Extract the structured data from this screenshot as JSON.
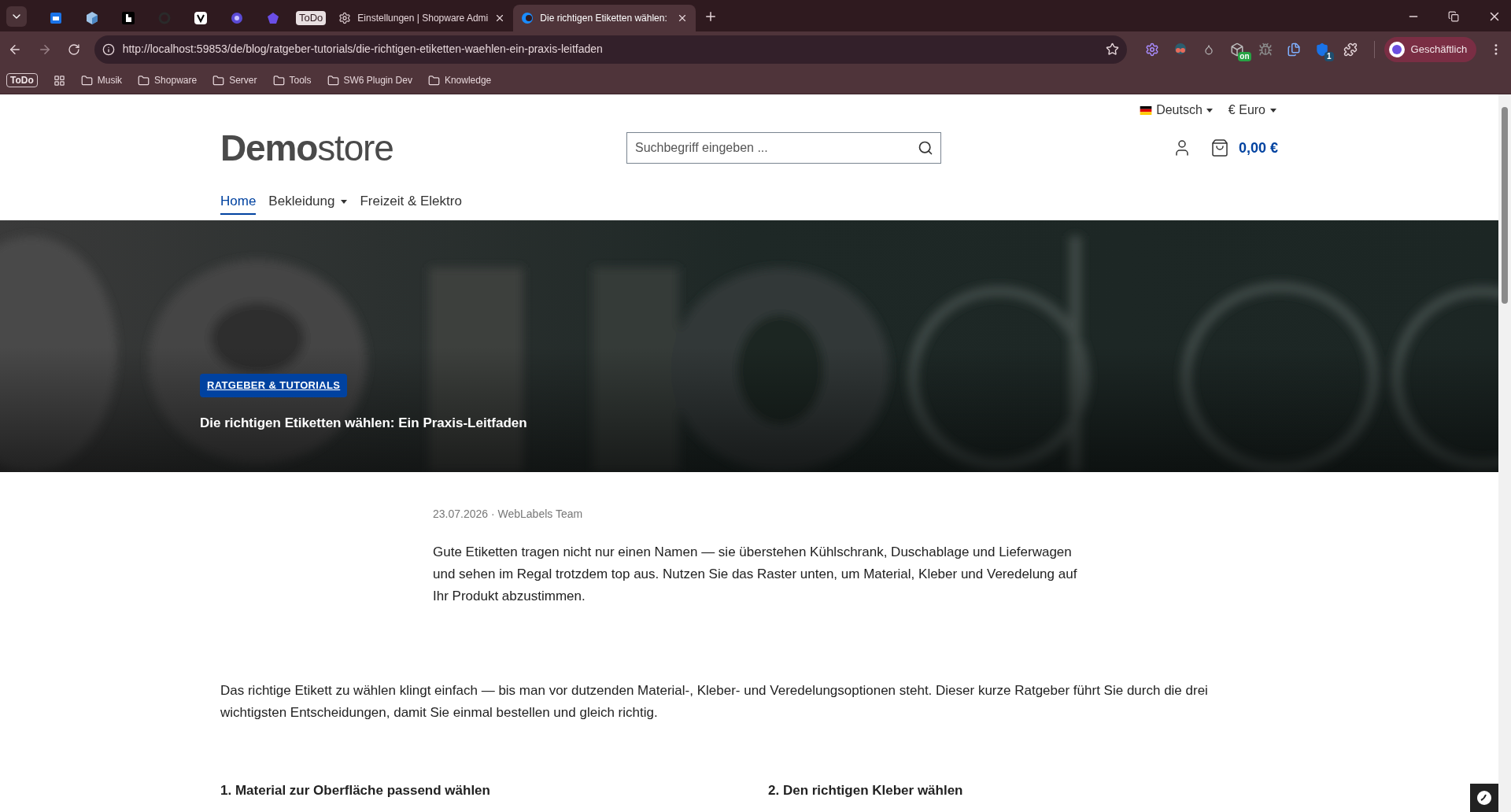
{
  "browser": {
    "tabs": [
      {
        "kind": "pinned",
        "selected": false
      },
      {
        "kind": "pinned",
        "selected": false
      },
      {
        "kind": "pinned",
        "selected": false
      },
      {
        "kind": "pinned",
        "selected": false
      },
      {
        "kind": "pinned",
        "selected": false
      },
      {
        "kind": "pinned",
        "selected": false
      },
      {
        "kind": "pinned",
        "selected": false
      },
      {
        "kind": "label",
        "label": "ToDo",
        "selected": false
      },
      {
        "kind": "page",
        "label": "Einstellungen | Shopware Admi",
        "selected": false
      },
      {
        "kind": "page",
        "label": "Die richtigen Etiketten wählen:",
        "selected": true
      }
    ],
    "address": "http://localhost:59853/de/blog/ratgeber-tutorials/die-richtigen-etiketten-waehlen-ein-praxis-leitfaden",
    "extensions": [
      {
        "kind": "gear"
      },
      {
        "kind": "goggles"
      },
      {
        "kind": "drop"
      },
      {
        "kind": "box",
        "badge": "on"
      },
      {
        "kind": "bug"
      },
      {
        "kind": "copy"
      },
      {
        "kind": "shield",
        "badge": "1"
      },
      {
        "kind": "puzzle"
      }
    ],
    "profile": "Geschäftlich",
    "bookmarks": [
      {
        "kind": "badge",
        "label": "ToDo"
      },
      {
        "kind": "apps"
      },
      {
        "kind": "folder",
        "label": "Musik"
      },
      {
        "kind": "folder",
        "label": "Shopware"
      },
      {
        "kind": "folder",
        "label": "Server"
      },
      {
        "kind": "folder",
        "label": "Tools"
      },
      {
        "kind": "folder",
        "label": "SW6 Plugin Dev"
      },
      {
        "kind": "folder",
        "label": "Knowledge"
      }
    ]
  },
  "store": {
    "language": "Deutsch",
    "currency": "€ Euro",
    "logo": {
      "bold": "Demo",
      "light": "store"
    },
    "search": {
      "placeholder": "Suchbegriff eingeben ..."
    },
    "cart_total": "0,00 €",
    "nav": [
      {
        "label": "Home",
        "selected": true,
        "dropdown": false
      },
      {
        "label": "Bekleidung",
        "selected": false,
        "dropdown": true
      },
      {
        "label": "Freizeit & Elektro",
        "selected": false,
        "dropdown": false
      }
    ]
  },
  "hero": {
    "category": "RATGEBER & TUTORIALS",
    "title": "Die richtigen Etiketten wählen: Ein Praxis-Leitfaden"
  },
  "article": {
    "meta": "23.07.2026 · WebLabels Team",
    "intro": "Gute Etiketten tragen nicht nur einen Namen — sie überstehen Kühlschrank, Duschablage und Lieferwagen und sehen im Regal trotzdem top aus. Nutzen Sie das Raster unten, um Material, Kleber und Veredelung auf Ihr Produkt abzustimmen.",
    "body": "Das richtige Etikett zu wählen klingt einfach — bis man vor dutzenden Material-, Kleber- und Veredelungsoptionen steht. Dieser kurze Ratgeber führt Sie durch die drei wichtigsten Entscheidungen, damit Sie einmal bestellen und gleich richtig.",
    "sections": [
      "1. Material zur Oberfläche passend wählen",
      "2. Den richtigen Kleber wählen"
    ]
  }
}
